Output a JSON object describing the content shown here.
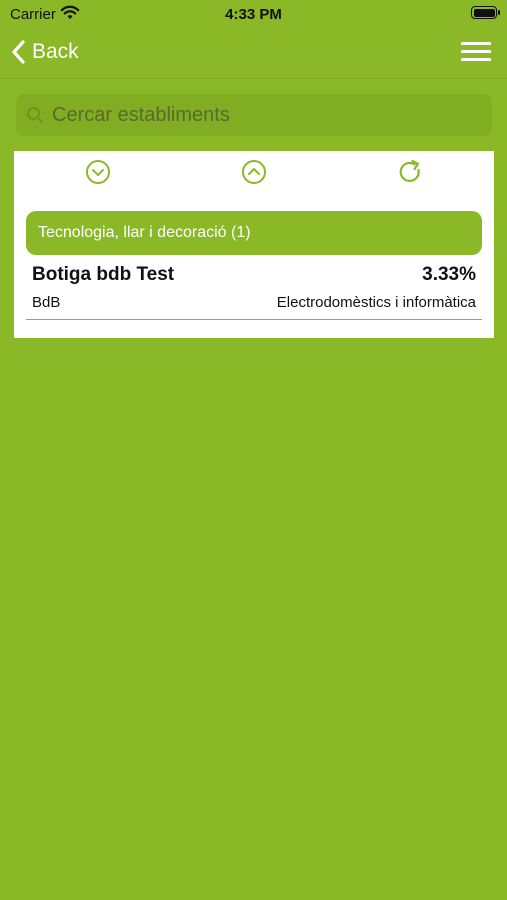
{
  "status_bar": {
    "carrier": "Carrier",
    "time": "4:33 PM"
  },
  "navbar": {
    "back_label": "Back",
    "back_icon": "chevron-left-icon",
    "menu_icon": "hamburger-menu-icon"
  },
  "search": {
    "placeholder": "Cercar establiments",
    "value": ""
  },
  "toolbar": {
    "icons": [
      "expand-all-icon",
      "collapse-all-icon",
      "refresh-icon"
    ]
  },
  "category": {
    "label": "Tecnologia, llar i decoració (1)"
  },
  "store": {
    "name": "Botiga bdb Test",
    "percentage": "3.33%",
    "brand": "BdB",
    "category": "Electrodomèstics i informàtica"
  },
  "colors": {
    "brand_green": "#8AB827",
    "panel_bg": "#FFFFFF",
    "text": "#111111"
  }
}
